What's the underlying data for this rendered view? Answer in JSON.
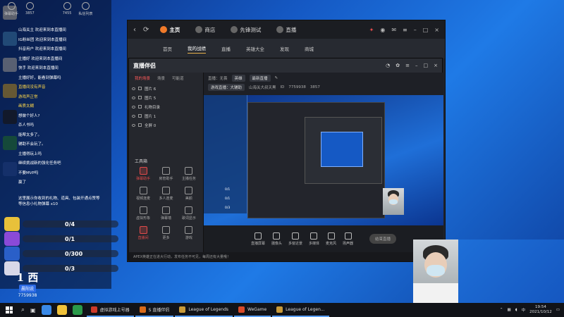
{
  "chat": {
    "header": [
      {
        "label": "弹幕助手",
        "icon": "barrage-icon"
      },
      {
        "label": "3857",
        "icon": "viewer-icon"
      },
      {
        "label": "7455",
        "icon": "fans-icon"
      },
      {
        "label": "私信列表",
        "icon": "message-icon"
      }
    ],
    "lines": [
      {
        "text": "山海关主 欢迎来到本直播间",
        "highlight": false
      },
      {
        "text": "IG粉丝团 欢迎来到本直播间",
        "highlight": false
      },
      {
        "text": "抖音用户 欢迎来到本直播间",
        "highlight": false
      },
      {
        "text": "主播好 欢迎来到本直播间",
        "highlight": false
      },
      {
        "text": "快手 欢迎来到本直播间",
        "highlight": false
      },
      {
        "text": "主播好好，能看到弹幕吗",
        "highlight": false
      },
      {
        "text": "直播间没有声音",
        "highlight": true
      },
      {
        "text": "游戏声正常",
        "highlight": true
      },
      {
        "text": "画质太糊",
        "highlight": true
      },
      {
        "text": "想做个好人?",
        "highlight": false
      },
      {
        "text": "杀人书吗",
        "highlight": false
      },
      {
        "text": "能帮太多了。",
        "highlight": false
      },
      {
        "text": "辅助不会玩了。",
        "highlight": false
      },
      {
        "text": "主播得玩上吗",
        "highlight": false
      },
      {
        "text": "继续挑战新的强化任务吧",
        "highlight": false
      },
      {
        "text": "不要MVP吗",
        "highlight": false
      },
      {
        "text": "赢了",
        "highlight": false
      }
    ],
    "gift_note": "这里展示你收到的礼物、道具、包装开通点赞等等信息小礼物弹幕",
    "gift_note_tail": "x10",
    "gifts": [
      {
        "count": "0/4",
        "progress": 0,
        "color": "#e8c13a"
      },
      {
        "count": "0/1",
        "progress": 0,
        "color": "#8a4ad8"
      },
      {
        "count": "0/300",
        "progress": 0,
        "color": "#2a5fc8"
      },
      {
        "count": "0/3",
        "progress": 0,
        "color": "#d8d8e8"
      }
    ],
    "brand": {
      "logo": "1 西",
      "name": "晨阳说",
      "id": "7759938"
    }
  },
  "app": {
    "tabs": [
      {
        "label": "主页",
        "active": true
      },
      {
        "label": "商店",
        "active": false
      },
      {
        "label": "先锋测试",
        "active": false
      },
      {
        "label": "直播",
        "active": false
      }
    ],
    "subnav": [
      {
        "label": "首页",
        "active": false
      },
      {
        "label": "我的战绩",
        "active": true
      },
      {
        "label": "直播",
        "active": false
      },
      {
        "label": "英雄大全",
        "active": false
      },
      {
        "label": "发现",
        "active": false
      },
      {
        "label": "商城",
        "active": false
      }
    ]
  },
  "companion": {
    "title": "直播伴侣",
    "left_tabs": [
      {
        "label": "我的场景",
        "active": true
      },
      {
        "label": "场景",
        "active": false
      },
      {
        "label": "可能道",
        "active": false
      }
    ],
    "scenes": [
      "图片 6",
      "图片 5",
      "礼物目录",
      "图片 1",
      "全屏 0"
    ],
    "tools_title": "工具箱",
    "tools": [
      {
        "label": "弹幕助手",
        "red": true
      },
      {
        "label": "房管助手",
        "red": false
      },
      {
        "label": "主播任务",
        "red": false
      },
      {
        "label": "视频连麦",
        "red": false
      },
      {
        "label": "多人连麦",
        "red": false
      },
      {
        "label": "美颜",
        "red": false
      },
      {
        "label": "虚拟形象",
        "red": false
      },
      {
        "label": "弹幕墙",
        "red": false
      },
      {
        "label": "歌词显示",
        "red": false
      },
      {
        "label": "直播间",
        "red": true
      },
      {
        "label": "更多",
        "red": false
      },
      {
        "label": "游戏",
        "red": false
      }
    ],
    "bar": {
      "title_label": "直播：无畏",
      "title_value": "英雄",
      "category": "最新直播",
      "id_label": "ID",
      "live_type": "游戏直播：大辅助",
      "user": "山海关大叔天黑",
      "room": "7759938",
      "viewers": "3857"
    },
    "mini_chat": [
      "0/1",
      "0/1",
      "0/3"
    ],
    "controls": [
      "直播屏幕",
      "摄像头",
      "多窗近景",
      "多媒体",
      "麦克风",
      "扬声器"
    ],
    "start_label": "结束直播",
    "status": "APEX英雄正在进大行动，发布任务不可见，每周还有大量哦！"
  },
  "taskbar": {
    "tasks": [
      {
        "label": "虚拟游戏上号器",
        "color": "#cc3a2a"
      },
      {
        "label": "S 直播伴侣",
        "color": "#d86a1a"
      },
      {
        "label": "League of Legends",
        "color": "#c89a3a"
      },
      {
        "label": "WeGame",
        "color": "#d84a2a"
      },
      {
        "label": "League of Legen...",
        "color": "#c89a3a"
      }
    ],
    "time": "19:54",
    "date": "2021/10/12"
  }
}
